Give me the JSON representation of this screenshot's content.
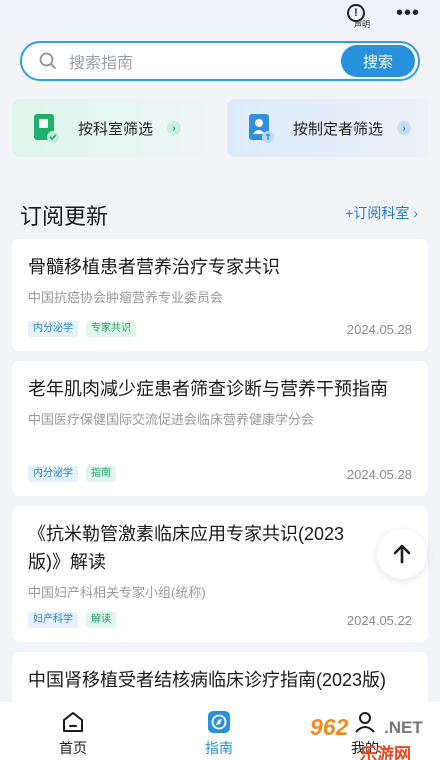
{
  "header": {
    "notice_label": "声明"
  },
  "search": {
    "placeholder": "搜索指南",
    "button_label": "搜索"
  },
  "filters": [
    {
      "label": "按科室筛选",
      "color": "#1fa065"
    },
    {
      "label": "按制定者筛选",
      "color": "#2a7fd6"
    }
  ],
  "section": {
    "title": "订阅更新",
    "link_label": "+订阅科室"
  },
  "cards": [
    {
      "title": "骨髓移植患者营养治疗专家共识",
      "org": "中国抗癌协会肿瘤营养专业委员会",
      "tags": [
        "内分泌学",
        "专家共识"
      ],
      "date": "2024.05.28"
    },
    {
      "title": "老年肌肉减少症患者筛查诊断与营养干预指南",
      "org": "中国医疗保健国际交流促进会临床营养健康学分会",
      "tags": [
        "内分泌学",
        "指南"
      ],
      "date": "2024.05.28"
    },
    {
      "title": "《抗米勒管激素临床应用专家共识(2023版)》解读",
      "org": "中国妇产科相关专家小组(统称)",
      "tags": [
        "妇产科学",
        "解读"
      ],
      "date": "2024.05.22"
    },
    {
      "title": "中国肾移植受者结核病临床诊疗指南(2023版)"
    }
  ],
  "tabbar": {
    "items": [
      {
        "label": "首页",
        "active": false
      },
      {
        "label": "指南",
        "active": true
      },
      {
        "label": "我的",
        "active": false
      }
    ],
    "accent": "#2791dc"
  },
  "watermark": {
    "number": "962",
    "net": ".NET",
    "text": "乐游网"
  }
}
